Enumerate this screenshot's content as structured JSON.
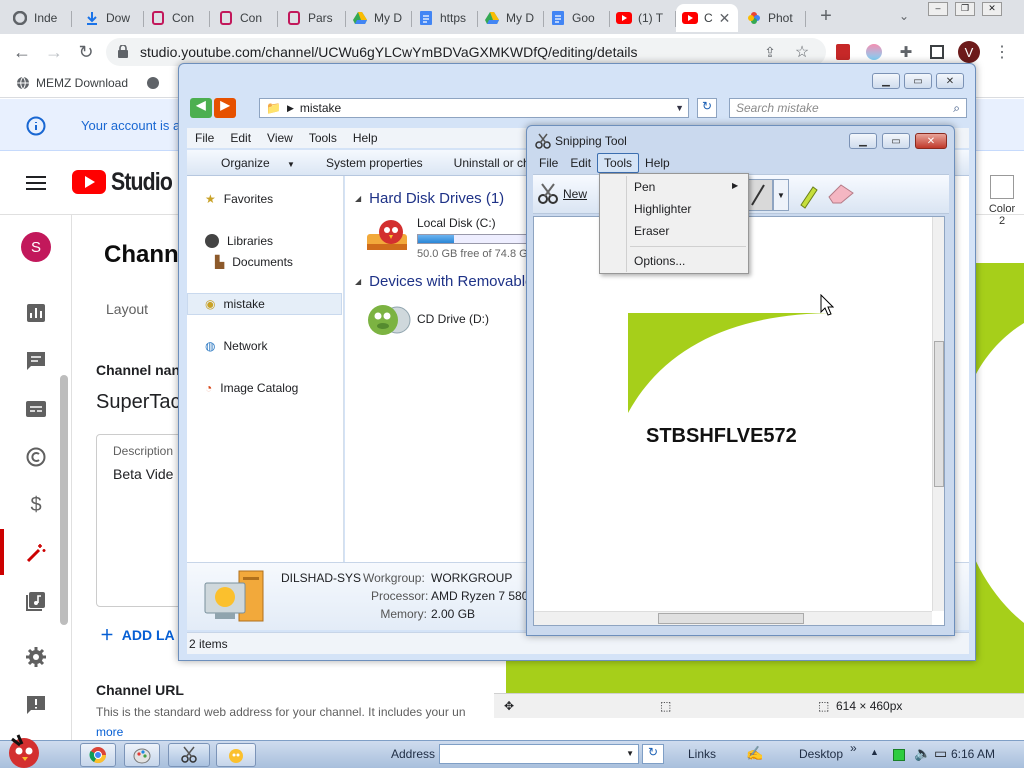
{
  "browser": {
    "tabs": [
      {
        "label": "Inde",
        "icon": "google-icon"
      },
      {
        "label": "Dow",
        "icon": "download-icon"
      },
      {
        "label": "Con",
        "icon": "bookmark-icon"
      },
      {
        "label": "Con",
        "icon": "bookmark-icon"
      },
      {
        "label": "Pars",
        "icon": "bookmark-icon"
      },
      {
        "label": "My D",
        "icon": "drive-icon"
      },
      {
        "label": "https",
        "icon": "docs-icon"
      },
      {
        "label": "My D",
        "icon": "drive-icon"
      },
      {
        "label": "Goo",
        "icon": "docs-icon"
      },
      {
        "label": "(1) T",
        "icon": "youtube-icon"
      },
      {
        "label": "C",
        "icon": "youtube-icon"
      },
      {
        "label": "Phot",
        "icon": "photos-icon"
      }
    ],
    "url": "studio.youtube.com/channel/UCWu6gYLCwYmBDVaGXMKWDfQ/editing/details",
    "bookmarks": [
      "MEMZ Download"
    ],
    "profile_initial": "V"
  },
  "youtube": {
    "notice": "Your account is a",
    "brand": "Studio",
    "avatar_initial": "S",
    "page_title": "Channe",
    "tab_layout": "Layout",
    "channel_name_label": "Channel nan",
    "channel_name_value": "SuperTac",
    "description_label": "Description",
    "description_value": "Beta Vide",
    "add_links": "ADD LA",
    "channel_url_heading": "Channel URL",
    "channel_url_desc": "This is the standard web address for your channel. It includes your un",
    "more": "more"
  },
  "explorer": {
    "address": "mistake",
    "search_placeholder": "Search mistake",
    "menu": [
      "File",
      "Edit",
      "View",
      "Tools",
      "Help"
    ],
    "commands": [
      "Organize",
      "System properties",
      "Uninstall or change a"
    ],
    "nav": {
      "favorites": "Favorites",
      "libraries": "Libraries",
      "documents": "Documents",
      "mistake": "mistake",
      "network": "Network",
      "image_catalog": "Image Catalog"
    },
    "hdd_group": "Hard Disk Drives (1)",
    "local_disk": "Local Disk (C:)",
    "local_disk_free": "50.0 GB free of 74.8 G",
    "local_disk_used_fraction": 0.33,
    "removable_group": "Devices with Removable",
    "cd_drive": "CD Drive (D:)",
    "details": {
      "computer": "DILSHAD-SYS",
      "workgroup_label": "Workgroup:",
      "workgroup": "WORKGROUP",
      "processor_label": "Processor:",
      "processor": "AMD Ryzen 7 5800",
      "memory_label": "Memory:",
      "memory": "2.00 GB"
    },
    "status": "2 items"
  },
  "snipping": {
    "title": "Snipping Tool",
    "menu": [
      "File",
      "Edit",
      "Tools",
      "Help"
    ],
    "new_label": "New",
    "captured_text": "STBSHFLVE572",
    "tools_menu": [
      "Pen",
      "Highlighter",
      "Eraser",
      "Options..."
    ]
  },
  "paint": {
    "color2_label": "Color",
    "color2_num": "2",
    "image_size": "614 × 460px"
  },
  "taskbar": {
    "address_label": "Address",
    "links_label": "Links",
    "desktop_label": "Desktop",
    "time": "6:16 AM"
  },
  "colors": {
    "accent_green": "#a6cf1a",
    "youtube_red": "#ff0000",
    "explorer_blue": "#d4e3f7"
  }
}
